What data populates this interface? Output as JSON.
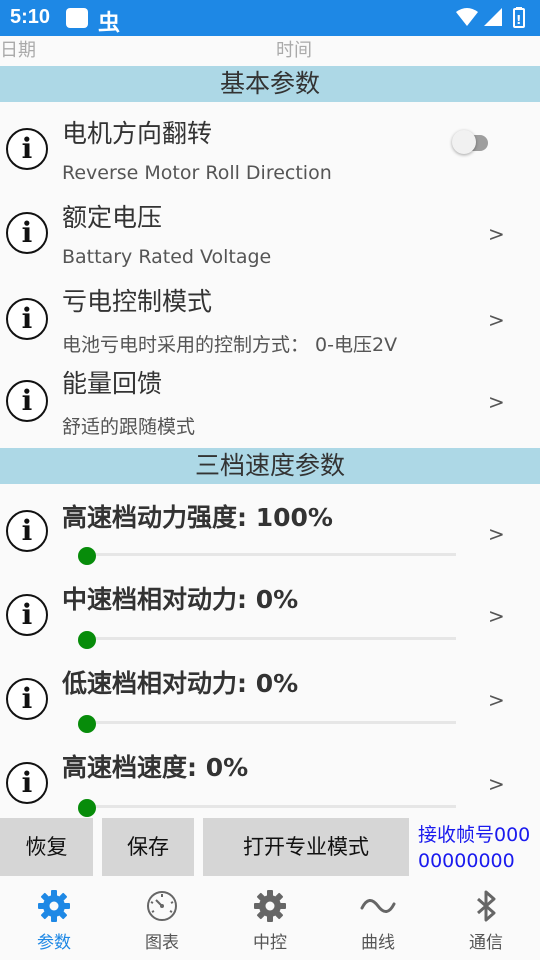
{
  "status_bar": {
    "time": "5:10",
    "notification_glyph": "虫"
  },
  "header": {
    "date_label": "日期",
    "time_label": "时间"
  },
  "sections": {
    "basic": "基本参数",
    "speed": "三档速度参数"
  },
  "settings": [
    {
      "title": "电机方向翻转",
      "subtitle": "Reverse Motor Roll Direction",
      "control": "switch",
      "checked": false
    },
    {
      "title": "额定电压",
      "subtitle": "Battary Rated Voltage",
      "arrow": ">"
    },
    {
      "title": "亏电控制模式",
      "subtitle": "电池亏电时采用的控制方式： 0-电压2V",
      "arrow": ">"
    },
    {
      "title": "能量回馈",
      "subtitle": "舒适的跟随模式",
      "arrow": ">"
    }
  ],
  "speed_settings": [
    {
      "title": "高速档动力强度: 100%",
      "slider_fraction": 0.0,
      "arrow": ">"
    },
    {
      "title": "中速档相对动力: 0%",
      "slider_fraction": 0.0,
      "arrow": ">"
    },
    {
      "title": "低速档相对动力: 0%",
      "slider_fraction": 0.0,
      "arrow": ">"
    },
    {
      "title": "高速档速度: 0%",
      "slider_fraction": 0.0,
      "arrow": ">"
    }
  ],
  "buttons": {
    "restore": "恢复",
    "save": "保存",
    "pro_mode": "打开专业模式"
  },
  "frame_label": "接收帧号00000000000",
  "nav": [
    {
      "label": "参数",
      "icon": "gear-icon",
      "active": true
    },
    {
      "label": "图表",
      "icon": "gauge-icon",
      "active": false
    },
    {
      "label": "中控",
      "icon": "gear-icon",
      "active": false
    },
    {
      "label": "曲线",
      "icon": "wave-icon",
      "active": false
    },
    {
      "label": "通信",
      "icon": "bluetooth-icon",
      "active": false
    }
  ],
  "colors": {
    "status_bar": "#1e88e5",
    "section_bg": "#add8e6",
    "slider_thumb": "#078c0a",
    "active_nav": "#1e88e5",
    "frame_text": "#1a1aee"
  }
}
